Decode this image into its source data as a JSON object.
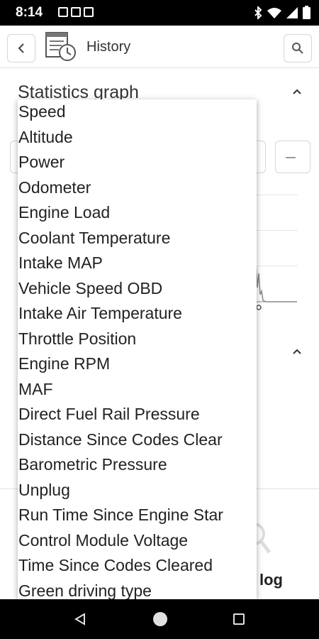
{
  "status_bar": {
    "time": "8:14"
  },
  "app_bar": {
    "title": "History",
    "back_icon": "chevron-left-icon",
    "history_icon": "history-clock-icon",
    "search_icon": "search-icon"
  },
  "background": {
    "section_title": "Statistics graph",
    "bottom_label": "log"
  },
  "dropdown": {
    "items": [
      "Speed",
      "Altitude",
      "Power",
      "Odometer",
      "Engine Load",
      "Coolant Temperature",
      "Intake MAP",
      "Vehicle Speed OBD",
      "Intake Air Temperature",
      "Throttle Position",
      "Engine RPM",
      "MAF",
      "Direct Fuel Rail Pressure",
      "Distance Since Codes Clear",
      "Barometric Pressure",
      "Unplug",
      "Run Time Since Engine Star",
      "Control Module Voltage",
      "Time Since Codes Cleared",
      "Green driving type"
    ]
  }
}
